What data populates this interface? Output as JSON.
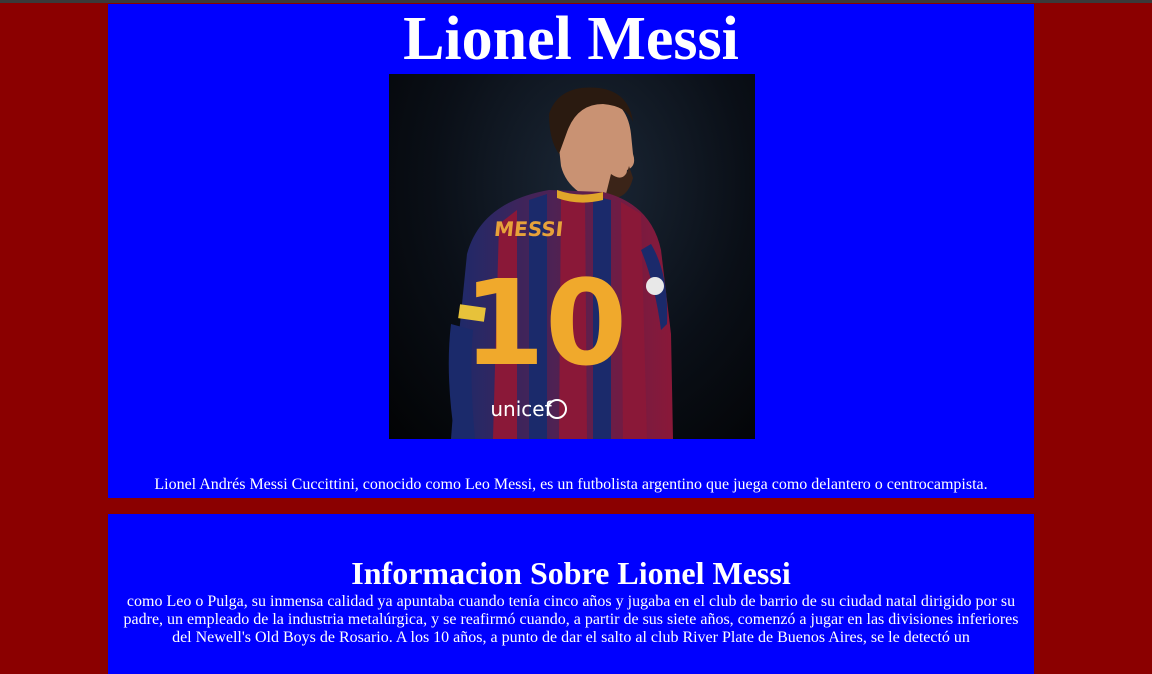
{
  "header": {
    "title": "Lionel Messi"
  },
  "hero": {
    "photo_alt": "Lionel Messi",
    "shirt_name": "MESSI",
    "shirt_number": "10",
    "sponsor": "unicef",
    "intro": "Lionel Andrés Messi Cuccittini, conocido como Leo Messi, es un futbolista argentino que juega como delantero o centrocampista."
  },
  "info": {
    "heading": "Informacion Sobre Lionel Messi",
    "text": "como Leo o Pulga, su inmensa calidad ya apuntaba cuando tenía cinco años y jugaba en el club de barrio de su ciudad natal dirigido por su padre, un empleado de la industria metalúrgica, y se reafirmó cuando, a partir de sus siete años, comenzó a jugar en las divisiones inferiores del Newell's Old Boys de Rosario. A los 10 años, a punto de dar el salto al club River Plate de Buenos Aires, se le detectó un"
  },
  "colors": {
    "page_background": "#8b0000",
    "card_background": "#0000ff",
    "text": "#ffffff"
  }
}
